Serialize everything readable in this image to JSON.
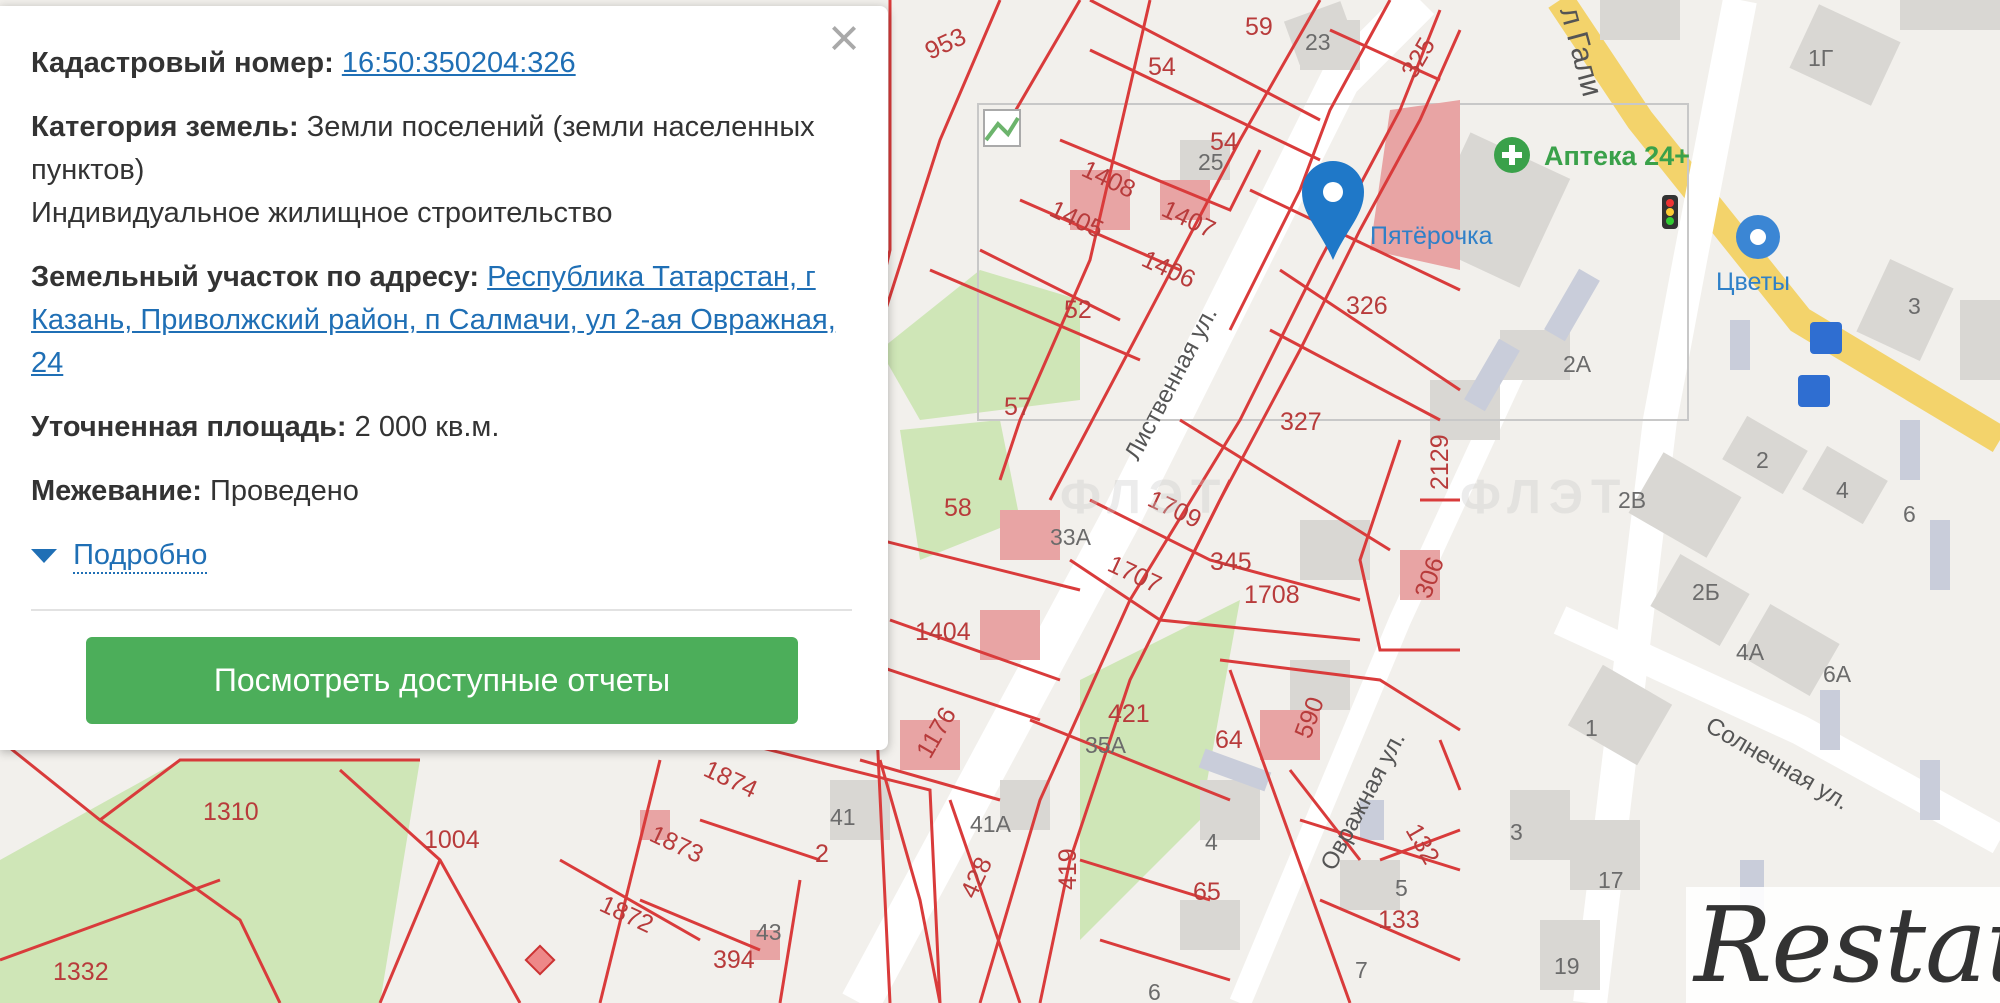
{
  "popup": {
    "cadastral_label": "Кадастровый номер:",
    "cadastral_value": "16:50:350204:326",
    "category_label": "Категория земель:",
    "category_value": "Земли поселений (земли населенных пунктов)",
    "usage_value": "Индивидуальное жилищное строительство",
    "address_label": "Земельный участок по адресу:",
    "address_value": "Республика Татарстан, г Казань, Приволжский район, п Салмачи, ул 2-ая Овражная, 24",
    "area_label": "Уточненная площадь:",
    "area_value": "2 000 кв.м.",
    "survey_label": "Межевание:",
    "survey_value": "Проведено",
    "more_label": "Подробно",
    "close_icon": "×",
    "reports_button": "Посмотреть доступные отчеты"
  },
  "map": {
    "parcel_labels": [
      "953",
      "54",
      "59",
      "325",
      "54",
      "1408",
      "1407",
      "1405",
      "1406",
      "52",
      "326",
      "327",
      "57",
      "58",
      "1709",
      "1707",
      "345",
      "1708",
      "2129",
      "306",
      "1404",
      "421",
      "35А",
      "64",
      "590",
      "1874",
      "1873",
      "1872",
      "394",
      "1310",
      "1004",
      "1332",
      "428",
      "419",
      "132",
      "133",
      "65",
      "2",
      "41",
      "41А",
      "43",
      "1176",
      "33А"
    ],
    "house_labels": [
      "23",
      "25",
      "2А",
      "1Г",
      "3",
      "2",
      "4",
      "6",
      "2В",
      "2Б",
      "4А",
      "6А",
      "1",
      "3",
      "17",
      "19",
      "4",
      "5",
      "7",
      "6"
    ],
    "streets": [
      "Лиственная ул.",
      "Овражная ул.",
      "Солнечная ул.",
      "л Гали"
    ],
    "pois": [
      "Аптека 24+",
      "Пятёрочка",
      "Цветы"
    ],
    "selected_parcel": "326"
  },
  "logo": {
    "text": "Restate"
  },
  "watermark": "ФЛЭТ",
  "colors": {
    "parcel_line": "#d93b3b",
    "road": "#f3d36b",
    "park": "#cfe6b7",
    "button": "#4cae5a",
    "link": "#1f6fb5",
    "marker": "#1f78c8"
  }
}
